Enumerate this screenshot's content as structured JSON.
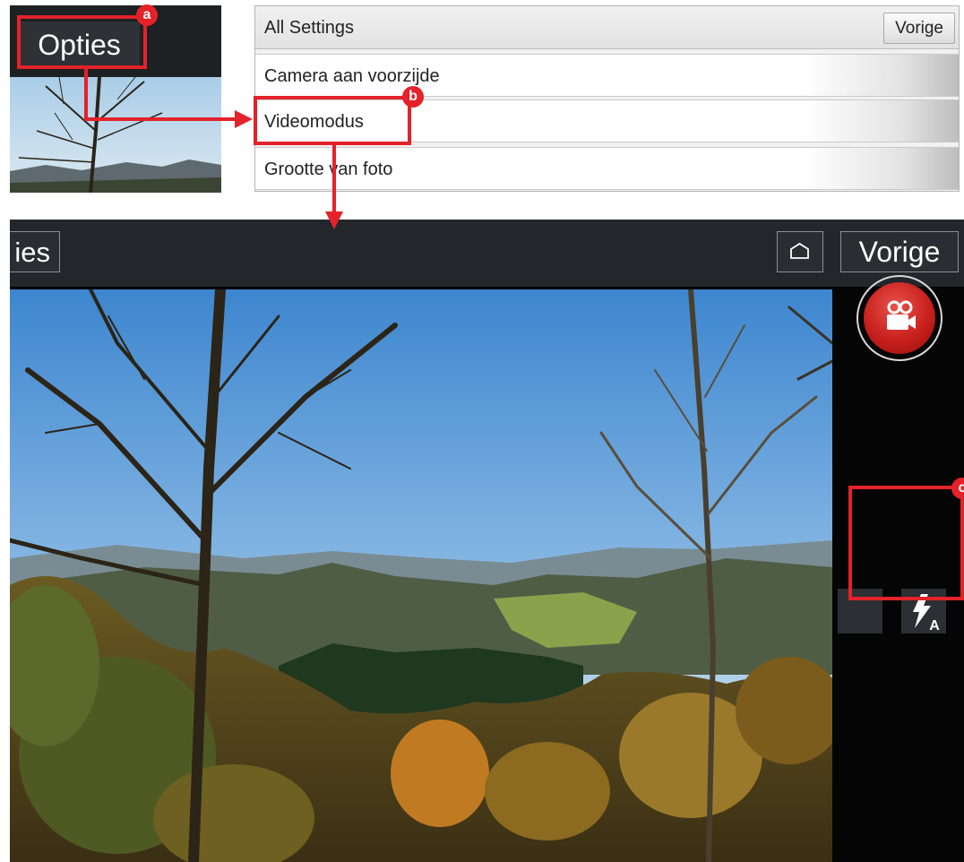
{
  "thumbnail": {
    "options_button": "Opties"
  },
  "settings": {
    "header_title": "All Settings",
    "back_button": "Vorige",
    "items": [
      {
        "label": "Camera aan voorzijde"
      },
      {
        "label": "Videomodus"
      },
      {
        "label": "Grootte van foto"
      }
    ]
  },
  "camera": {
    "options_button_partial": "ies",
    "home_icon": "home-icon",
    "back_button": "Vorige",
    "record_icon": "video-camera-icon",
    "record_color": "#c8201c",
    "flash_icon": "flash-auto-icon",
    "flash_mode_letter": "A"
  },
  "annotations": {
    "color": "#e3222a",
    "labels": [
      "a",
      "b",
      "c"
    ]
  }
}
